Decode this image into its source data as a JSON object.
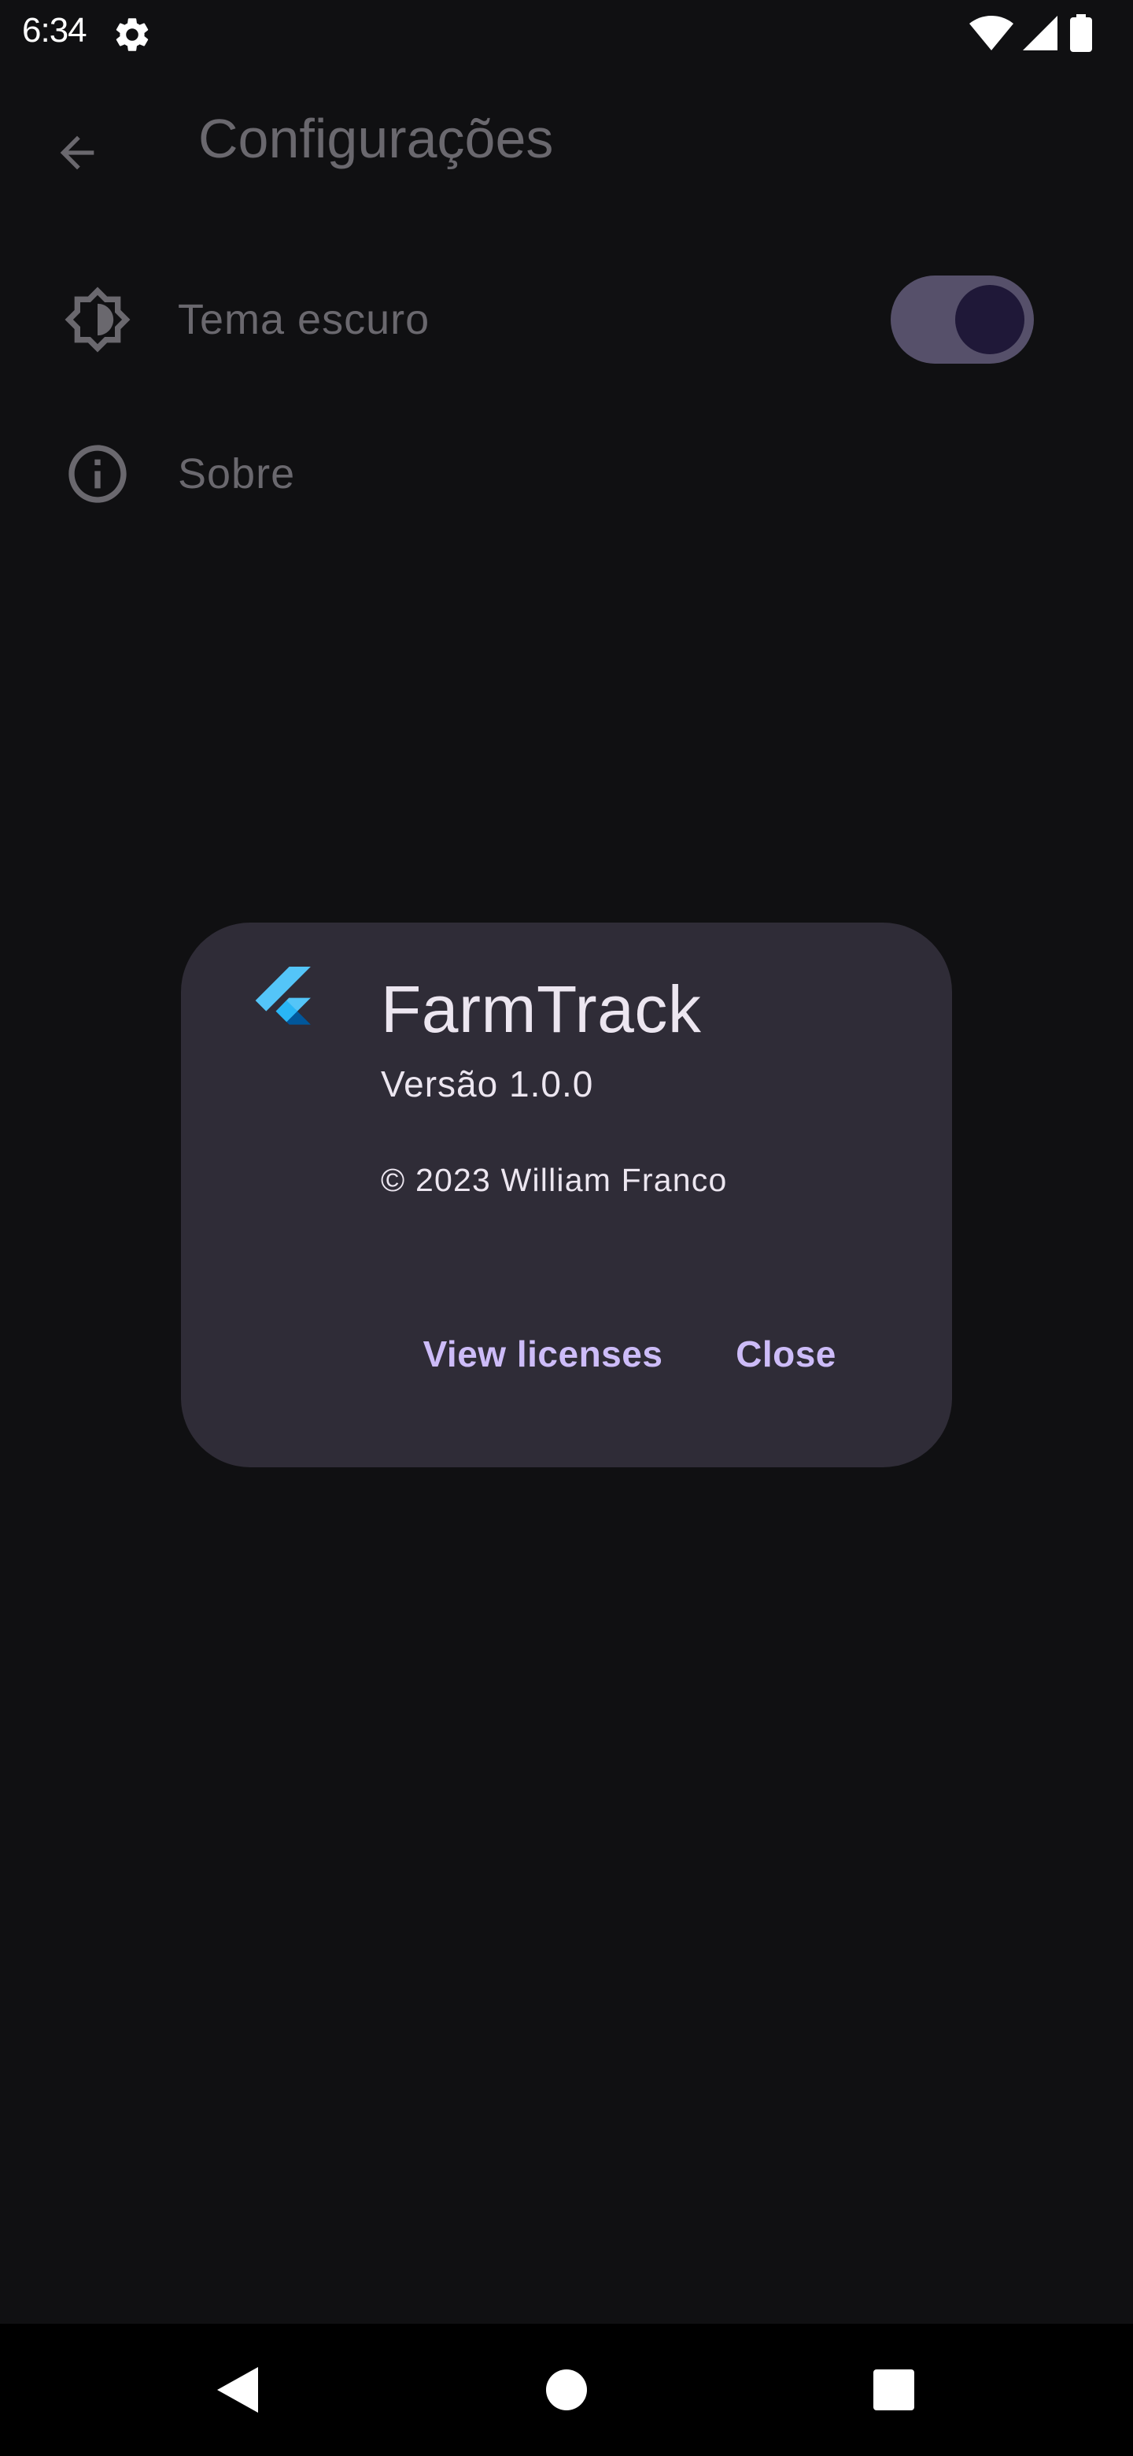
{
  "status_bar": {
    "time": "6:34",
    "icons": [
      "settings-gear-icon",
      "wifi-icon",
      "cellular-signal-icon",
      "battery-icon"
    ]
  },
  "app_bar": {
    "title": "Configurações",
    "back_icon": "arrow-back-icon"
  },
  "settings": {
    "items": [
      {
        "label": "Tema escuro",
        "icon": "brightness-icon",
        "toggle_on": true
      },
      {
        "label": "Sobre",
        "icon": "info-icon"
      }
    ]
  },
  "dialog": {
    "app_name": "FarmTrack",
    "version": "Versão 1.0.0",
    "legalese": "© 2023 William Franco",
    "logo_icon": "flutter-logo-icon",
    "actions": {
      "view_licenses": "View licenses",
      "close": "Close"
    }
  },
  "nav_bar": {
    "icons": [
      "nav-back-icon",
      "nav-home-icon",
      "nav-recents-icon"
    ]
  },
  "colors": {
    "background": "#101012",
    "dialog_background": "#2f2c37",
    "accent": "#cdbcf8",
    "toggle_track": "#56506a",
    "toggle_thumb": "#1f1838",
    "dim_text": "#6a686e"
  }
}
